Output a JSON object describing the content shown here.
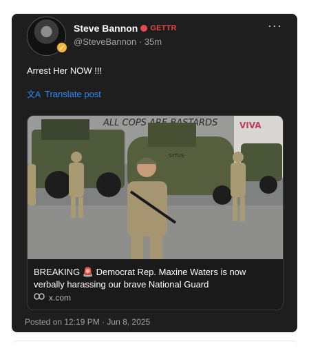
{
  "post": {
    "author_name": "Steve Bannon",
    "platform_label": "GETTR",
    "handle": "@SteveBannon",
    "time_ago": "35m",
    "handle_time": "@SteveBannon · 35m",
    "more_label": "···",
    "text": "Arrest Her NOW !!!",
    "translate_label": "Translate post",
    "footer": "Posted on 12:19 PM · Jun 8, 2025"
  },
  "embed": {
    "headline": "BREAKING 🚨 Democrat Rep. Maxine Waters is now verbally harassing our brave National Guard",
    "link_text": "x.com",
    "wall_graffiti": "ALL COPS ARE BASTARDS",
    "sign_text": "VIVA",
    "truck_stencil": "SYTUS"
  },
  "icons": {
    "avatar": "avatar-photo",
    "verified": "verified-badge-icon",
    "platform": "gettr-icon",
    "translate": "translate-icon",
    "link": "link-icon"
  },
  "colors": {
    "card_bg": "#1e1e1e",
    "link_blue": "#2f8cff",
    "gettr_red": "#e5484d",
    "badge_gold": "#f2b63a"
  }
}
